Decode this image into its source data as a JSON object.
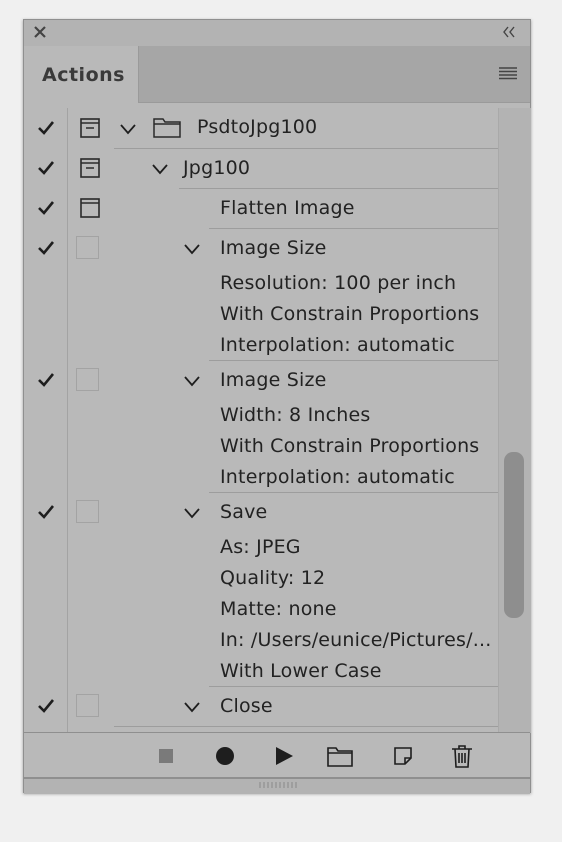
{
  "panel": {
    "tab_label": "Actions",
    "icons": {
      "close": "close-icon",
      "collapse": "double-chevron-left-icon",
      "menu": "hamburger-menu-icon"
    }
  },
  "rows": {
    "set": {
      "label": "PsdtoJpg100",
      "checked": true
    },
    "action": {
      "label": "Jpg100",
      "checked": true
    },
    "flatten": {
      "label": "Flatten Image",
      "checked": true
    },
    "size1": {
      "label": "Image Size",
      "params": [
        "Resolution: 100 per inch",
        "With Constrain Proportions",
        "Interpolation: automatic"
      ]
    },
    "size2": {
      "label": "Image Size",
      "params": [
        "Width: 8 Inches",
        "With Constrain Proportions",
        "Interpolation: automatic"
      ]
    },
    "save": {
      "label": "Save",
      "params": [
        "As: JPEG",
        "Quality: 12",
        "Matte: none",
        "In: /Users/eunice/Pictures/...",
        "With Lower Case"
      ]
    },
    "close": {
      "label": "Close"
    }
  },
  "toolbar": {
    "stop": "stop-icon",
    "record": "record-icon",
    "play": "play-icon",
    "new_set": "folder-icon",
    "new_action": "new-item-icon",
    "delete": "trash-icon"
  },
  "colors": {
    "panel_bg": "#b9b9b9",
    "tab_bar": "#a6a6a6",
    "scroll_thumb": "#8e8e8e",
    "text": "#222222"
  }
}
